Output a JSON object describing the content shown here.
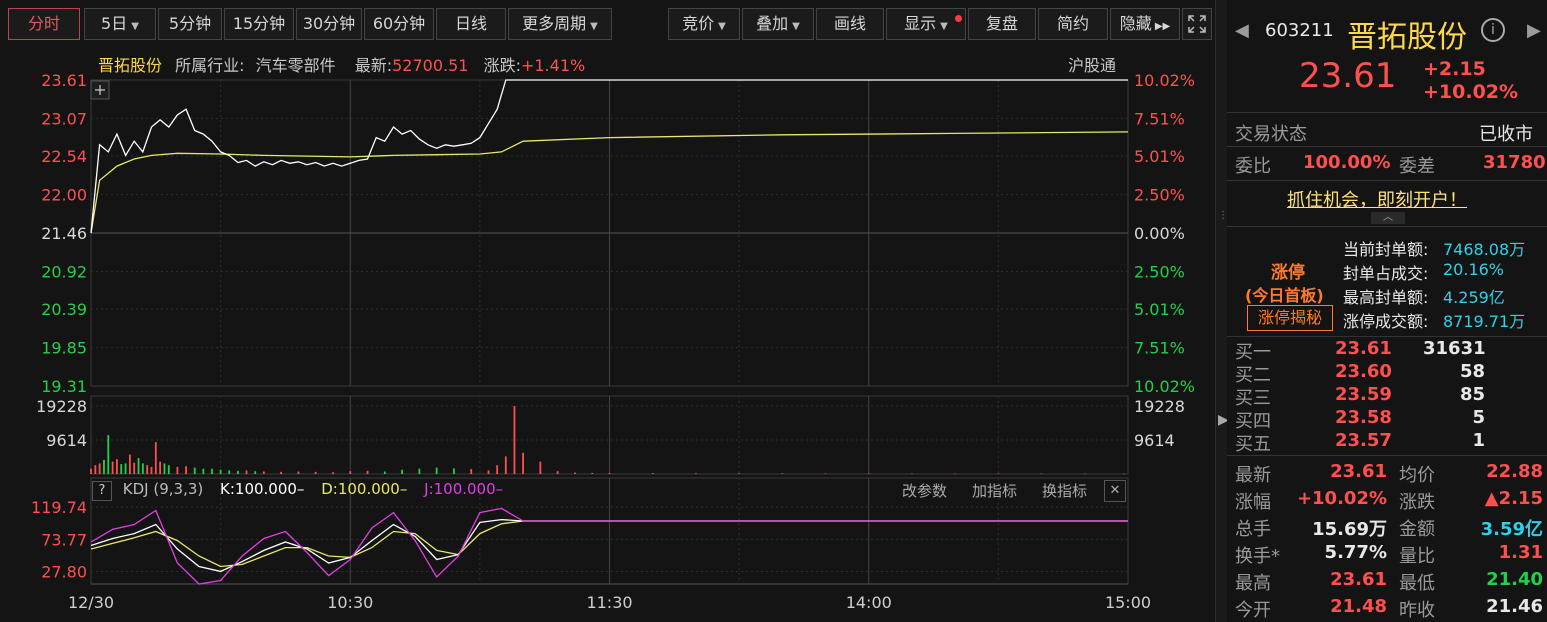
{
  "toolbar": {
    "periods": [
      "分时",
      "5日",
      "5分钟",
      "15分钟",
      "30分钟",
      "60分钟",
      "日线",
      "更多周期"
    ],
    "tools": [
      "竞价",
      "叠加",
      "画线",
      "显示",
      "复盘",
      "简约",
      "隐藏"
    ]
  },
  "info_bar": {
    "name": "晋拓股份",
    "industry_label": "所属行业:",
    "industry": "汽车零部件",
    "latest_label": "最新:",
    "latest": "52700.51",
    "change_label": "涨跌:",
    "change": "+1.41%",
    "connect": "沪股通"
  },
  "kdj_bar": {
    "help": "?",
    "name": "KDJ (9,3,3)",
    "k": "K:100.000–",
    "d": "D:100.000–",
    "j": "J:100.000–",
    "edit": "改参数",
    "add": "加指标",
    "switch": "换指标",
    "close": "✕"
  },
  "colors": {
    "up": "#ff5050",
    "down": "#23d04b",
    "price_line": "#ffffff",
    "avg_line": "#e8e86a",
    "k_line": "#ffffff",
    "d_line": "#e8e86a",
    "j_line": "#e040e0",
    "grid": "#3a3a3a",
    "accent": "#e05a5a"
  },
  "chart_data": {
    "type": "line",
    "x_ticks": [
      "12/30",
      "10:30",
      "11:30",
      "14:00",
      "15:00"
    ],
    "price_axis": {
      "ticks": [
        "23.61",
        "23.07",
        "22.54",
        "22.00",
        "21.46",
        "20.92",
        "20.39",
        "19.85",
        "19.31"
      ],
      "pct_ticks": [
        "10.02%",
        "7.51%",
        "5.01%",
        "2.50%",
        "0.00%",
        "2.50%",
        "5.01%",
        "7.51%",
        "10.02%"
      ],
      "ylim": [
        19.31,
        23.61
      ],
      "prev_close": 21.46
    },
    "volume_axis": {
      "ticks": [
        "19228",
        "9614"
      ],
      "ylim": [
        0,
        19228
      ]
    },
    "kdj_axis": {
      "ticks": [
        "119.74",
        "73.77",
        "27.80"
      ],
      "ylim": [
        10,
        130
      ]
    },
    "minutes_total": 240,
    "series": [
      {
        "name": "price",
        "x": [
          0,
          2,
          4,
          6,
          8,
          10,
          12,
          14,
          16,
          18,
          20,
          22,
          24,
          26,
          28,
          30,
          32,
          34,
          36,
          38,
          40,
          42,
          44,
          46,
          48,
          50,
          52,
          54,
          56,
          58,
          60,
          62,
          64,
          66,
          68,
          70,
          72,
          74,
          76,
          78,
          80,
          82,
          84,
          86,
          88,
          90,
          92,
          94,
          96,
          100,
          240
        ],
        "values": [
          21.46,
          22.7,
          22.6,
          22.85,
          22.55,
          22.75,
          22.6,
          22.95,
          23.05,
          22.95,
          23.12,
          23.2,
          22.9,
          22.85,
          22.75,
          22.6,
          22.55,
          22.45,
          22.48,
          22.4,
          22.46,
          22.42,
          22.48,
          22.44,
          22.46,
          22.42,
          22.45,
          22.4,
          22.44,
          22.4,
          22.44,
          22.48,
          22.5,
          22.8,
          22.75,
          22.95,
          22.85,
          22.9,
          22.78,
          22.7,
          22.65,
          22.7,
          22.68,
          22.7,
          22.72,
          22.8,
          23.0,
          23.2,
          23.61,
          23.61,
          23.61
        ]
      },
      {
        "name": "avg",
        "x": [
          0,
          2,
          4,
          6,
          8,
          10,
          14,
          20,
          30,
          40,
          60,
          70,
          80,
          90,
          95,
          100,
          120,
          160,
          200,
          240
        ],
        "values": [
          21.46,
          22.2,
          22.3,
          22.4,
          22.45,
          22.5,
          22.55,
          22.58,
          22.57,
          22.55,
          22.53,
          22.55,
          22.56,
          22.57,
          22.6,
          22.75,
          22.8,
          22.84,
          22.86,
          22.88
        ]
      },
      {
        "name": "volume",
        "x": [
          0,
          1,
          2,
          3,
          4,
          5,
          6,
          7,
          8,
          9,
          10,
          11,
          12,
          13,
          14,
          15,
          16,
          17,
          18,
          20,
          22,
          24,
          26,
          28,
          30,
          32,
          34,
          36,
          38,
          40,
          44,
          48,
          52,
          56,
          60,
          64,
          68,
          72,
          76,
          80,
          84,
          88,
          92,
          94,
          96,
          98,
          100,
          104,
          108,
          112,
          116,
          120,
          130,
          140,
          150,
          160,
          170,
          180,
          190,
          200,
          210,
          220,
          230,
          239
        ],
        "values": [
          1500,
          2500,
          3000,
          4000,
          11000,
          3500,
          4200,
          2800,
          3000,
          5500,
          3200,
          4500,
          3000,
          2500,
          2000,
          9000,
          3500,
          3000,
          2500,
          2000,
          2200,
          1800,
          1500,
          1500,
          1200,
          1000,
          900,
          1000,
          800,
          700,
          600,
          700,
          600,
          500,
          800,
          900,
          700,
          1200,
          1500,
          1800,
          1600,
          1400,
          1000,
          2500,
          5000,
          19228,
          6000,
          3500,
          800,
          400,
          300,
          300,
          250,
          200,
          200,
          200,
          150,
          150,
          150,
          120,
          120,
          120,
          120,
          100
        ]
      },
      {
        "name": "K",
        "x": [
          0,
          5,
          10,
          15,
          20,
          25,
          30,
          35,
          40,
          45,
          50,
          55,
          60,
          65,
          70,
          75,
          80,
          85,
          90,
          95,
          100,
          110,
          120,
          240
        ],
        "values": [
          65,
          75,
          82,
          95,
          60,
          35,
          28,
          42,
          58,
          70,
          60,
          40,
          48,
          72,
          95,
          78,
          45,
          52,
          98,
          102,
          100,
          100,
          100,
          100
        ]
      },
      {
        "name": "D",
        "x": [
          0,
          5,
          10,
          15,
          20,
          25,
          30,
          35,
          40,
          45,
          50,
          55,
          60,
          65,
          70,
          75,
          80,
          85,
          90,
          95,
          100,
          110,
          120,
          240
        ],
        "values": [
          60,
          68,
          76,
          85,
          72,
          50,
          35,
          38,
          50,
          62,
          62,
          50,
          48,
          62,
          85,
          82,
          58,
          52,
          82,
          96,
          100,
          100,
          100,
          100
        ]
      },
      {
        "name": "J",
        "x": [
          0,
          5,
          10,
          15,
          20,
          25,
          30,
          35,
          40,
          45,
          50,
          55,
          60,
          65,
          70,
          75,
          80,
          85,
          90,
          95,
          100,
          110,
          120,
          240
        ],
        "values": [
          70,
          88,
          95,
          115,
          40,
          10,
          15,
          50,
          75,
          85,
          55,
          22,
          45,
          90,
          112,
          72,
          20,
          50,
          112,
          118,
          100,
          100,
          100,
          100
        ]
      }
    ]
  },
  "panel": {
    "code": "603211",
    "name": "晋拓股份",
    "price": "23.61",
    "change": "+2.15",
    "change_pct": "+10.02%",
    "status_label": "交易状态",
    "status": "已收市",
    "wb_label": "委比",
    "wb": "100.00%",
    "wc_label": "委差",
    "wc": "31780",
    "promo": "抓住机会，即刻开户！",
    "limit_title": "涨停",
    "limit_sub": "(今日首板)",
    "limit_btn": "涨停揭秘",
    "seal_rows": [
      {
        "label": "当前封单额:",
        "value": "7468.08万"
      },
      {
        "label": "封单占成交:",
        "value": "20.16%"
      },
      {
        "label": "最高封单额:",
        "value": "4.259亿"
      },
      {
        "label": "涨停成交额:",
        "value": "8719.71万"
      }
    ],
    "bids": [
      {
        "label": "买一",
        "price": "23.61",
        "vol": "31631"
      },
      {
        "label": "买二",
        "price": "23.60",
        "vol": "58"
      },
      {
        "label": "买三",
        "price": "23.59",
        "vol": "85"
      },
      {
        "label": "买四",
        "price": "23.58",
        "vol": "5"
      },
      {
        "label": "买五",
        "price": "23.57",
        "vol": "1"
      }
    ],
    "stats": [
      {
        "l1": "最新",
        "v1": "23.61",
        "c1": "red",
        "l2": "均价",
        "v2": "22.88",
        "c2": "red"
      },
      {
        "l1": "涨幅",
        "v1": "+10.02%",
        "c1": "red",
        "l2": "涨跌",
        "v2": "▲2.15",
        "c2": "red"
      },
      {
        "l1": "总手",
        "v1": "15.69万",
        "c1": "white",
        "l2": "金额",
        "v2": "3.59亿",
        "c2": "cyan"
      },
      {
        "l1": "换手*",
        "v1": "5.77%",
        "c1": "white",
        "l2": "量比",
        "v2": "1.31",
        "c2": "red"
      },
      {
        "l1": "最高",
        "v1": "23.61",
        "c1": "red",
        "l2": "最低",
        "v2": "21.40",
        "c2": "green"
      },
      {
        "l1": "今开",
        "v1": "21.48",
        "c1": "red",
        "l2": "昨收",
        "v2": "21.46",
        "c2": "white"
      }
    ]
  }
}
